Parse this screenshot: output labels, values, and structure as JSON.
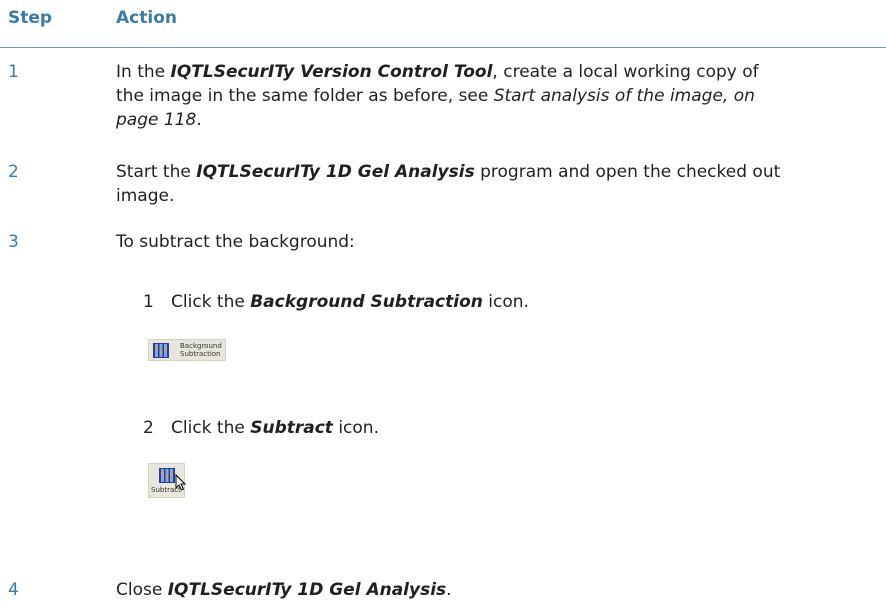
{
  "header": {
    "step": "Step",
    "action": "Action"
  },
  "steps": [
    {
      "num": "1",
      "line1_pre": "In the ",
      "line1_bold": "IQTLSecurITy Version Control Tool",
      "line1_post": ", create a local working copy of",
      "line2_pre": "the image in the same folder as before, see ",
      "line2_italic": "Start analysis of the image, on",
      "line3_italic": "page 118",
      "line3_post": "."
    },
    {
      "num": "2",
      "line1_pre": "Start the ",
      "line1_bold": "IQTLSecurITy 1D Gel Analysis",
      "line1_post": " program and open the checked out",
      "line2": "image."
    },
    {
      "num": "3",
      "line1": "To subtract the background:",
      "sub": [
        {
          "num": "1",
          "pre": "Click the ",
          "bold": "Background Subtraction",
          "post": " icon."
        },
        {
          "num": "2",
          "pre": "Click the ",
          "bold": "Subtract",
          "post": " icon."
        }
      ]
    },
    {
      "num": "4",
      "pre": "Close ",
      "bold": "IQTLSecurITy 1D Gel Analysis",
      "post": "."
    }
  ],
  "buttons": {
    "background_subtraction": {
      "line1": "Background",
      "line2": "Subtraction",
      "icon": "gel-lanes-icon"
    },
    "subtract": {
      "label": "Subtract",
      "icon": "gel-lanes-icon"
    }
  },
  "colors": {
    "accent": "#3b7ba8",
    "text": "#231f20",
    "rule": "#6fa1c4"
  }
}
